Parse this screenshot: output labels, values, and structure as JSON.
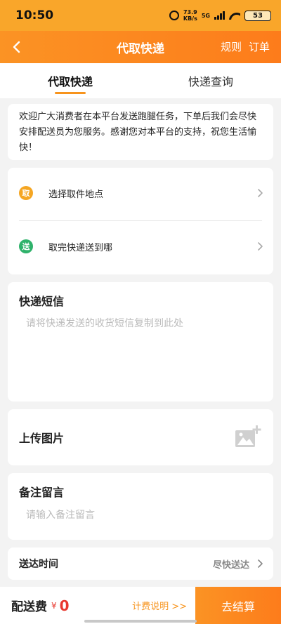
{
  "status_bar": {
    "time": "10:50",
    "net_speed_value": "73.9",
    "net_speed_unit": "KB/s",
    "net_type": "5G",
    "battery": "53"
  },
  "nav": {
    "title": "代取快递",
    "rules_label": "规则",
    "orders_label": "订单"
  },
  "tabs": [
    {
      "label": "代取快递",
      "active": true
    },
    {
      "label": "快递查询",
      "active": false
    }
  ],
  "notice": {
    "text": "欢迎广大消费者在本平台发送跑腿任务，下单后我们会尽快安排配送员为您服务。感谢您对本平台的支持，祝您生活愉快！"
  },
  "locations": {
    "pickup": {
      "badge": "取",
      "label": "选择取件地点"
    },
    "dropoff": {
      "badge": "送",
      "label": "取完快递送到哪"
    }
  },
  "sms": {
    "title": "快递短信",
    "placeholder": "请将快递发送的收货短信复制到此处"
  },
  "upload": {
    "title": "上传图片"
  },
  "remark": {
    "title": "备注留言",
    "placeholder": "请输入备注留言"
  },
  "delivery": {
    "label": "送达时间",
    "value": "尽快送达"
  },
  "bottom": {
    "fee_label": "配送费",
    "currency": "¥",
    "fee_value": "0",
    "fee_link": "计费说明 >>",
    "checkout_label": "去结算"
  },
  "colors": {
    "accent": "#fd8a20",
    "pickup_badge": "#f5a623",
    "dropoff_badge": "#2fb26b",
    "price": "#e8382f"
  },
  "icons": [
    "back-icon",
    "alarm-icon",
    "signal-icon",
    "wifi-icon",
    "battery-icon",
    "chevron-right-icon",
    "add-image-icon"
  ]
}
